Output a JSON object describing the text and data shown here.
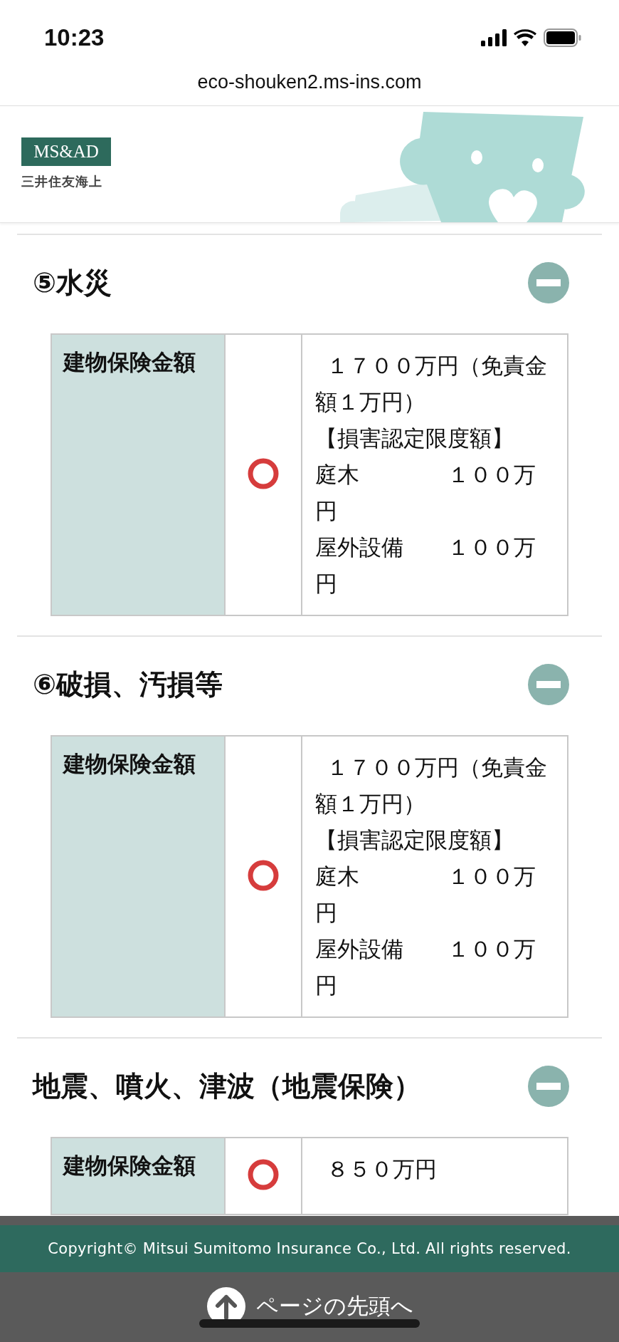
{
  "status_bar": {
    "time": "10:23"
  },
  "browser": {
    "url": "eco-shouken2.ms-ins.com"
  },
  "header": {
    "logo_mark": "MS&AD",
    "logo_name": "三井住友海上"
  },
  "sections": [
    {
      "title": "⑤水災",
      "expanded": true,
      "rows": [
        {
          "label": "建物保険金額",
          "covered": true,
          "lines": [
            " １７００万円（免責金額１万円）",
            "【損害認定限度額】",
            "庭木　　　　１００万円",
            "屋外設備　　１００万円"
          ]
        }
      ]
    },
    {
      "title": "⑥破損、汚損等",
      "expanded": true,
      "rows": [
        {
          "label": "建物保険金額",
          "covered": true,
          "lines": [
            " １７００万円（免責金額１万円）",
            "【損害認定限度額】",
            "庭木　　　　１００万円",
            "屋外設備　　１００万円"
          ]
        }
      ]
    },
    {
      "title": "地震、噴火、津波（地震保険）",
      "expanded": true,
      "rows": [
        {
          "label": "建物保険金額",
          "covered": true,
          "lines": [
            " ８５０万円"
          ]
        }
      ]
    }
  ],
  "footer": {
    "copyright": "Copyright© Mitsui Sumitomo Insurance Co., Ltd. All rights reserved.",
    "back_to_top": "ページの先頭へ"
  }
}
